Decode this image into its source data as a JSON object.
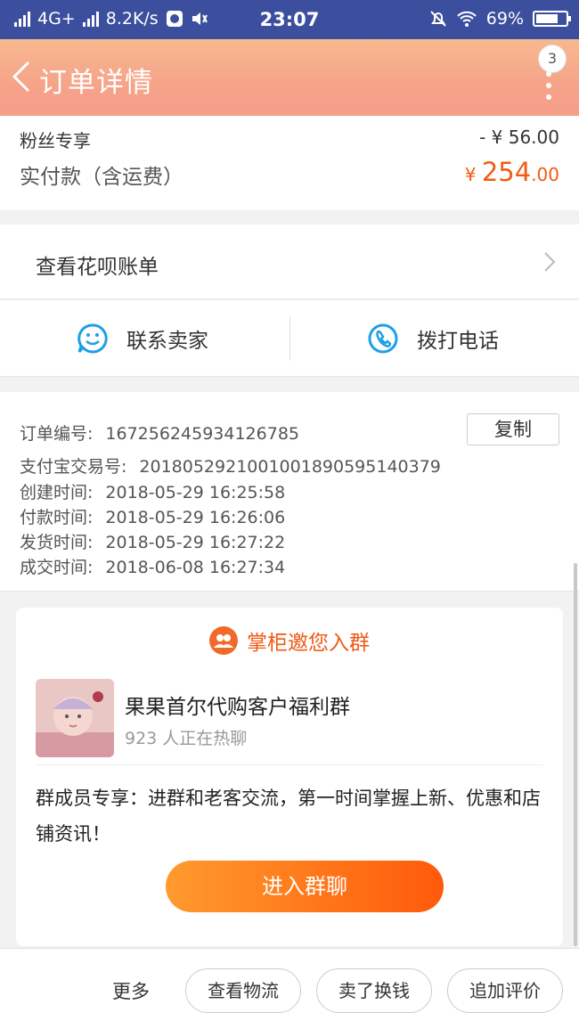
{
  "status_bar": {
    "network": "4G+",
    "speed": "8.2K/s",
    "time": "23:07",
    "battery": "69%",
    "icons": [
      "signal-icon",
      "image-icon",
      "volume-icon",
      "mute-bell-icon",
      "wifi-icon",
      "battery-icon"
    ]
  },
  "nav": {
    "title": "订单详情",
    "badge_count": "3"
  },
  "price": {
    "discount_label": "粉丝专享",
    "discount_value": "- ¥ 56.00",
    "paid_label": "实付款（含运费）",
    "paid_currency": "¥ ",
    "paid_integer": "254",
    "paid_decimal": ".00",
    "accent_color": "#f25b13"
  },
  "huabei": {
    "label": "查看花呗账单"
  },
  "contact": {
    "seller_label": "联系卖家",
    "phone_label": "拨打电话",
    "icon_color": "#1ea0e6"
  },
  "order_info": {
    "copy_label": "复制",
    "rows": [
      {
        "key": "订单编号:",
        "value": "167256245934126785"
      },
      {
        "key": "支付宝交易号:",
        "value": "2018052921001001890595140379"
      },
      {
        "key": "创建时间:",
        "value": "2018-05-29 16:25:58"
      },
      {
        "key": "付款时间:",
        "value": "2018-05-29 16:26:06"
      },
      {
        "key": "发货时间:",
        "value": "2018-05-29 16:27:22"
      },
      {
        "key": "成交时间:",
        "value": "2018-06-08 16:27:34"
      }
    ]
  },
  "group": {
    "header": "掌柜邀您入群",
    "name": "果果首尔代购客户福利群",
    "member_count": "923 人正在热聊",
    "description": "群成员专享：进群和老客交流，第一时间掌握上新、优惠和店铺资讯！",
    "join_label": "进入群聊"
  },
  "bottom_bar": {
    "more_label": "更多",
    "logistics_label": "查看物流",
    "resell_label": "卖了换钱",
    "review_label": "追加评价"
  }
}
